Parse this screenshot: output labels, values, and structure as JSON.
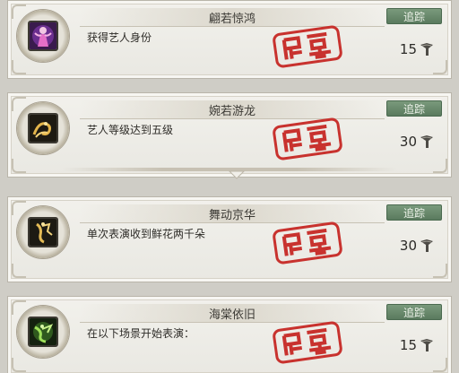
{
  "achievements": [
    {
      "title": "翩若惊鸿",
      "description": "获得艺人身份",
      "track_label": "追踪",
      "reward": "15",
      "icon": "dancer-portrait-icon",
      "stamp": "seal-stamp-icon",
      "reward_icon": "coin-fan-icon"
    },
    {
      "title": "婉若游龙",
      "description": "艺人等级达到五级",
      "track_label": "追踪",
      "reward": "30",
      "icon": "gold-dragon-icon",
      "stamp": "seal-stamp-icon",
      "reward_icon": "coin-fan-icon"
    },
    {
      "title": "舞动京华",
      "description": "单次表演收到鲜花两千朵",
      "track_label": "追踪",
      "reward": "30",
      "icon": "gold-dancer-icon",
      "stamp": "seal-stamp-icon",
      "reward_icon": "coin-fan-icon"
    },
    {
      "title": "海棠依旧",
      "description": "在以下场景开始表演：",
      "track_label": "追踪",
      "reward": "15",
      "icon": "green-dancer-icon",
      "stamp": "seal-stamp-icon",
      "reward_icon": "coin-fan-icon"
    }
  ],
  "colors": {
    "track_button": "#6a8a6d",
    "stamp_red": "#c8322e"
  }
}
